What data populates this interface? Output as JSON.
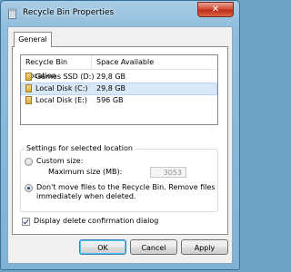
{
  "window": {
    "title": "Recycle Bin Properties",
    "close_glyph": "✕"
  },
  "tabs": [
    {
      "label": "General"
    }
  ],
  "locations": {
    "headers": [
      "Recycle Bin Location",
      "Space Available"
    ],
    "rows": [
      {
        "name": "Games SSD (D:)",
        "space": "29,8 GB",
        "selected": false
      },
      {
        "name": "Local Disk (C:)",
        "space": "29,8 GB",
        "selected": true
      },
      {
        "name": "Local Disk (E:)",
        "space": "596 GB",
        "selected": false
      }
    ]
  },
  "settings": {
    "group_label": "Settings for selected location",
    "custom_size_label": "Custom size:",
    "max_size_label": "Maximum size (MB):",
    "max_size_value": "3053",
    "dont_move_label_line1": "Don't move files to the Recycle Bin. Remove files",
    "dont_move_label_line2": "immediately when deleted.",
    "selected_option": "dont_move"
  },
  "confirm": {
    "label": "Display delete confirmation dialog",
    "checked": true
  },
  "buttons": {
    "ok": "OK",
    "cancel": "Cancel",
    "apply": "Apply"
  },
  "colors": {
    "selection": "#d9e8f7",
    "close_button": "#c7422b"
  }
}
